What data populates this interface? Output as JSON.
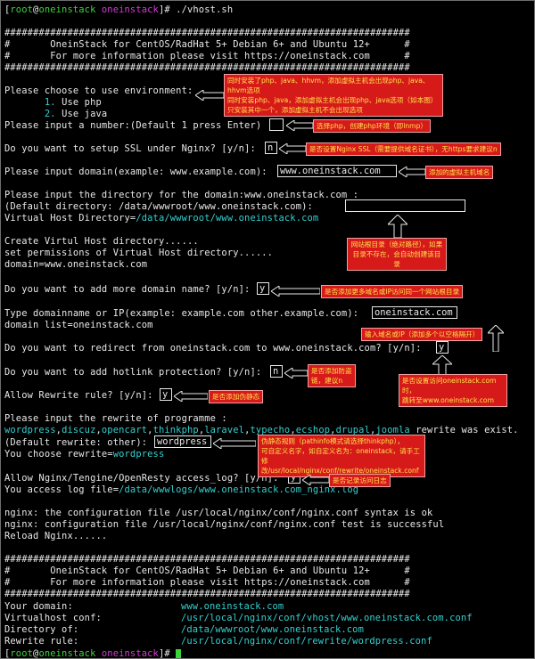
{
  "colors": {
    "background": "#000000",
    "text": "#e8e8e8",
    "cyan": "#35d0d0",
    "green": "#39d639",
    "magenta": "#d63ad6",
    "note_bg": "#d61a1a",
    "note_text": "#ffe14a"
  },
  "prompt": {
    "open": "[",
    "user": "root",
    "at": "@",
    "host": "oneinstack",
    "dir": "oneinstack",
    "close": "]#",
    "command": "./vhost.sh"
  },
  "banner": {
    "rule": "#######################################################################",
    "line1": "#       OneinStack for CentOS/RadHat 5+ Debian 6+ and Ubuntu 12+      #",
    "line2": "#       For more information please visit https://oneinstack.com      #"
  },
  "env": {
    "question": "Please choose to use environment:",
    "opt1_num": "1.",
    "opt1": "Use php",
    "opt2_num": "2.",
    "opt2": "Use java"
  },
  "number_prompt": "Please input a number:(Default 1 press Enter)",
  "ssl_prompt": "Do you want to setup SSL under Nginx? [y/n]:",
  "ssl_answer": "n",
  "domain_prompt": "Please input domain(example: www.example.com):",
  "domain_answer": "www.oneinstack.com",
  "dir_prompt": "Please input the directory for the domain:www.oneinstack.com :",
  "dir_default": "(Default directory: /data/wwwroot/www.oneinstack.com):",
  "vhost_dir_label": "Virtual Host Directory=",
  "vhost_dir_value": "/data/wwwroot/www.oneinstack.com",
  "create_1": "Create Virtul Host directory......",
  "create_2": "set permissions of Virtual Host directory......",
  "create_3": "domain=www.oneinstack.com",
  "more_domain_prompt": "Do you want to add more domain name? [y/n]:",
  "more_domain_answer": "y",
  "type_domain_prompt": "Type domainname or IP(example: example.com other.example.com):",
  "type_domain_answer": "oneinstack.com",
  "domain_list": "domain list=oneinstack.com",
  "redirect_prompt": "Do you want to redirect from oneinstack.com to www.oneinstack.com? [y/n]:",
  "redirect_answer": "y",
  "hotlink_prompt": "Do you want to add hotlink protection? [y/n]:",
  "hotlink_answer": "n",
  "rewrite_prompt": "Allow Rewrite rule? [y/n]:",
  "rewrite_answer": "y",
  "programme_prompt": "Please input the rewrite of programme :",
  "programmes": [
    "wordpress",
    "discuz",
    "opencart",
    "thinkphp",
    "laravel",
    "typecho",
    "ecshop",
    "drupal",
    "joomla"
  ],
  "rewrite_exist": " rewrite was exist.",
  "default_rewrite": "(Default rewrite: other):",
  "rewrite_choice": "wordpress",
  "choose_rewrite_label": "You choose rewrite=",
  "choose_rewrite_value": "wordpress",
  "log_prompt": "Allow Nginx/Tengine/OpenResty access_log? [y/n]:",
  "log_answer": "y",
  "log_label": "You access log file=",
  "log_value": "/data/wwwlogs/www.oneinstack.com_nginx.log",
  "nginx_1": "nginx: the configuration file /usr/local/nginx/conf/nginx.conf syntax is ok",
  "nginx_2": "nginx: configuration file /usr/local/nginx/conf/nginx.conf test is successful",
  "nginx_3": "Reload Nginx......",
  "summary": {
    "domain_label": "Your domain:",
    "domain_value": "www.oneinstack.com",
    "vconf_label": "Virtualhost conf:",
    "vconf_value": "/usr/local/nginx/conf/vhost/www.oneinstack.com.conf",
    "dir_label": "Directory of:",
    "dir_value": "/data/wwwroot/www.oneinstack.com",
    "rule_label": "Rewrite rule:",
    "rule_value": "/usr/local/nginx/conf/rewrite/wordpress.conf"
  },
  "notes": {
    "env_1": "同时安装了php、java、hhvm，添加虚拟主机会出现php、java、hhvm选项",
    "env_2": "同时安装php、java，添加虚拟主机会出现php、java选项（如本图）",
    "env_3": "只安装其中一个，添加虚拟主机不会出现选项",
    "number": "选择php，创建php环境（即lnmp）",
    "ssl": "是否设置Nginx SSL（需要提供域名证书），无https要求建议n",
    "domain": "添加的虚拟主机域名",
    "dir_1": "网站根目录（绝对路径），如果",
    "dir_2": "目录不存在，会自动创建该目录",
    "more_domain": "是否添加更多域名或IP访问同一个网站根目录",
    "type_domain": "输入域名或IP（添加多个以空格隔开）",
    "redirect_1": "是否设置访问oneinstack.com时，",
    "redirect_2": "跳转至www.oneinstack.com",
    "hotlink_1": "是否添加防盗",
    "hotlink_2": "链，建议n",
    "rewrite": "是否添加伪静态",
    "pseudo_1": "伪静态规则（pathinfo模式请选择thinkphp），",
    "pseudo_2": "可自定义名字，如自定义名为：oneinstack，请手工修",
    "pseudo_3": "改/usr/local/nginx/conf/rewrite/oneinstack.conf",
    "log": "是否记录访问日志"
  }
}
